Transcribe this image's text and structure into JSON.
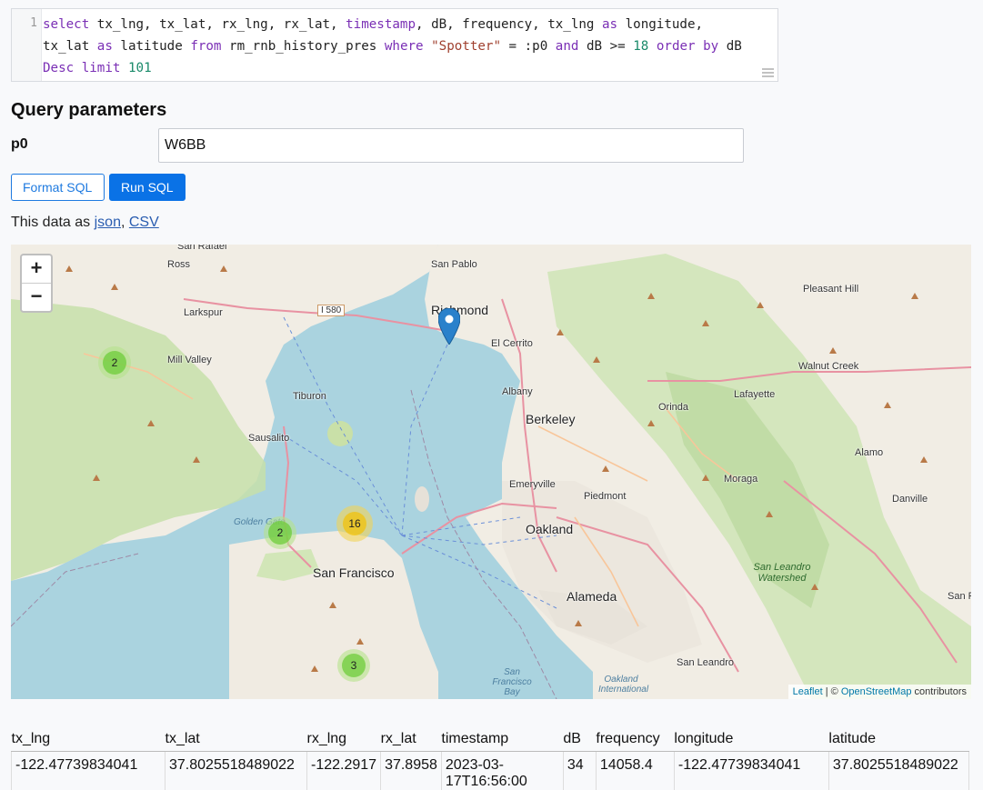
{
  "editor": {
    "line_number": "1"
  },
  "params": {
    "title": "Query parameters",
    "label": "p0",
    "value": "W6BB"
  },
  "buttons": {
    "format": "Format SQL",
    "run": "Run SQL"
  },
  "links": {
    "prefix": "This data as ",
    "json": "json",
    "sep": ",",
    "csv": "CSV"
  },
  "map": {
    "zoom_in": "+",
    "zoom_out": "−",
    "clusters": [
      "2",
      "2",
      "16",
      "3"
    ],
    "labels": {
      "richmond": "Richmond",
      "san_pablo": "San Pablo",
      "el_cerrito": "El Cerrito",
      "albany": "Albany",
      "berkeley": "Berkeley",
      "emeryville": "Emeryville",
      "piedmont": "Piedmont",
      "oakland": "Oakland",
      "alameda": "Alameda",
      "san_francisco": "San Francisco",
      "sausalito": "Sausalito",
      "tiburon": "Tiburon",
      "larkspur": "Larkspur",
      "ross": "Ross",
      "mill_valley": "Mill Valley",
      "san_rafael": "San Rafael",
      "orinda": "Orinda",
      "lafayette": "Lafayette",
      "moraga": "Moraga",
      "pleasant_hill": "Pleasant Hill",
      "walnut_creek": "Walnut Creek",
      "alamo": "Alamo",
      "danville": "Danville",
      "san_leandro": "San Leandro",
      "san_leandro_watershed": "San Leandro Watershed",
      "golden_gate": "Golden Gate",
      "sf_bay": "San Francisco Bay",
      "oakland_airport": "Oakland International",
      "san_r": "San R",
      "i580": "I 580"
    },
    "attribution": {
      "leaflet": "Leaflet",
      "sep": " | © ",
      "osm": "OpenStreetMap",
      "suffix": " contributors"
    }
  },
  "table": {
    "headers": [
      "tx_lng",
      "tx_lat",
      "rx_lng",
      "rx_lat",
      "timestamp",
      "dB",
      "frequency",
      "longitude",
      "latitude"
    ],
    "rows": [
      [
        "-122.47739834041",
        "37.8025518489022",
        "-122.2917",
        "37.8958",
        "2023-03-17T16:56:00",
        "34",
        "14058.4",
        "-122.47739834041",
        "37.8025518489022"
      ]
    ]
  }
}
